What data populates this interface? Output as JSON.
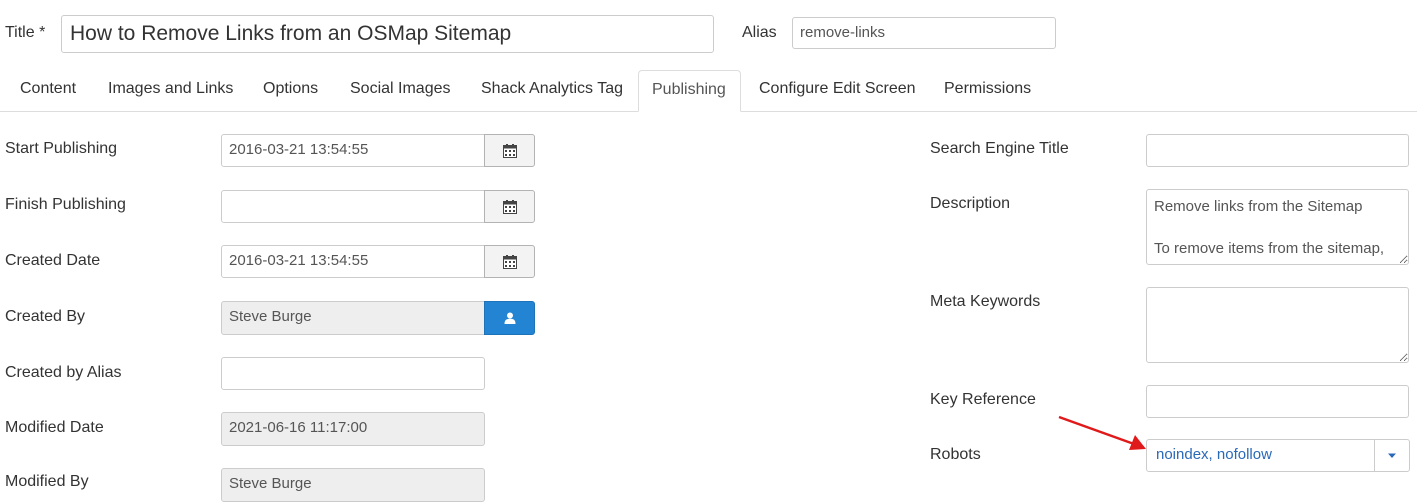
{
  "header": {
    "title_label": "Title *",
    "title_value": "How to Remove Links from an OSMap Sitemap",
    "alias_label": "Alias",
    "alias_value": "remove-links"
  },
  "tabs": [
    {
      "label": "Content"
    },
    {
      "label": "Images and Links"
    },
    {
      "label": "Options"
    },
    {
      "label": "Social Images"
    },
    {
      "label": "Shack Analytics Tag"
    },
    {
      "label": "Publishing",
      "active": true
    },
    {
      "label": "Configure Edit Screen"
    },
    {
      "label": "Permissions"
    }
  ],
  "publishing": {
    "start_label": "Start Publishing",
    "start_value": "2016-03-21 13:54:55",
    "finish_label": "Finish Publishing",
    "finish_value": "",
    "created_label": "Created Date",
    "created_value": "2016-03-21 13:54:55",
    "created_by_label": "Created By",
    "created_by_value": "Steve Burge",
    "created_alias_label": "Created by Alias",
    "created_alias_value": "",
    "modified_label": "Modified Date",
    "modified_value": "2021-06-16 11:17:00",
    "modified_by_label": "Modified By",
    "modified_by_value": "Steve Burge"
  },
  "metadata": {
    "se_title_label": "Search Engine Title",
    "se_title_value": "",
    "description_label": "Description",
    "description_value": "Remove links from the Sitemap\n\nTo remove items from the sitemap,\nyou",
    "keywords_label": "Meta Keywords",
    "keywords_value": "",
    "key_ref_label": "Key Reference",
    "key_ref_value": "",
    "robots_label": "Robots",
    "robots_value": "noindex, nofollow"
  },
  "icons": {
    "calendar": "calendar-icon",
    "user": "user-icon",
    "caret": "chevron-down-icon"
  },
  "colors": {
    "accent_blue": "#2384d3",
    "link_blue": "#2a69b8",
    "annotation_red": "#e0191a"
  }
}
